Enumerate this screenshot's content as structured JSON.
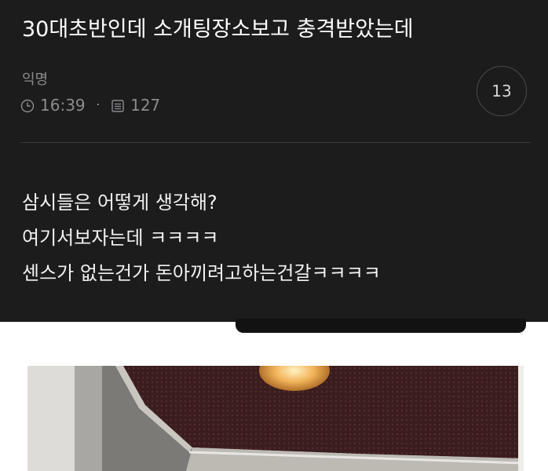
{
  "post": {
    "title": "30대초반인데 소개팅장소보고 충격받았는데",
    "author": "익명",
    "time": "16:39",
    "views": "127",
    "separator": "·",
    "comment_count": "13",
    "body_lines": [
      "삼시들은 어떻게 생각해?",
      "여기서보자는데 ㅋㅋㅋㅋ",
      "센스가 없는건가 돈아끼려고하는건갈ㅋㅋㅋㅋ"
    ]
  },
  "icons": {
    "time": "clock-icon",
    "views": "document-icon"
  },
  "colors": {
    "card_background": "#1c1c1d",
    "meta_text": "#8c8c8e",
    "body_text": "#f2f2f2"
  }
}
